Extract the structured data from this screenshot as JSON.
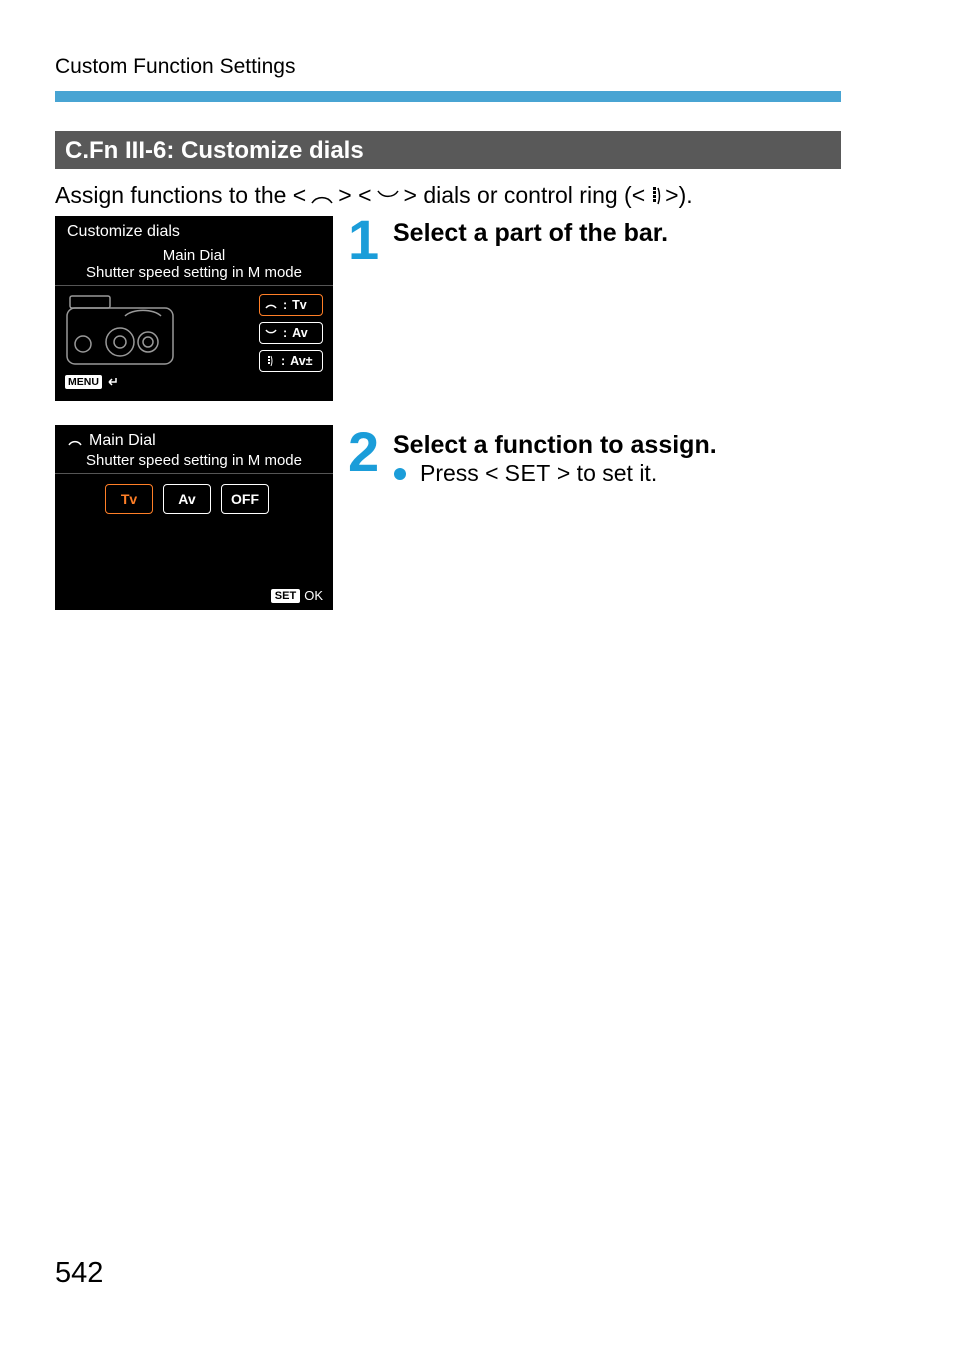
{
  "header": {
    "section": "Custom Function Settings"
  },
  "heading": "C.Fn III-6: Customize dials",
  "intro": {
    "prefix": "Assign functions to the <",
    "mid1": "> <",
    "mid2": "> dials or control ring (<",
    "suffix": ">)."
  },
  "screenshot1": {
    "title": "Customize dials",
    "dial_name": "Main Dial",
    "dial_function": "Shutter speed setting in M mode",
    "legend": {
      "tv": "Tv",
      "av": "Av",
      "av_pm": "Av±"
    },
    "menu_label": "MENU"
  },
  "screenshot2": {
    "title": "Main Dial",
    "subtitle": "Shutter speed setting in M mode",
    "options": [
      "Tv",
      "Av",
      "OFF"
    ],
    "set_label": "SET",
    "ok_label": "OK"
  },
  "steps": {
    "s1": {
      "num": "1",
      "heading": "Select a part of the bar."
    },
    "s2": {
      "num": "2",
      "heading": "Select a function to assign.",
      "bullet_pre": "Press <",
      "bullet_set": "SET",
      "bullet_post": "> to set it."
    }
  },
  "page_number": "542"
}
